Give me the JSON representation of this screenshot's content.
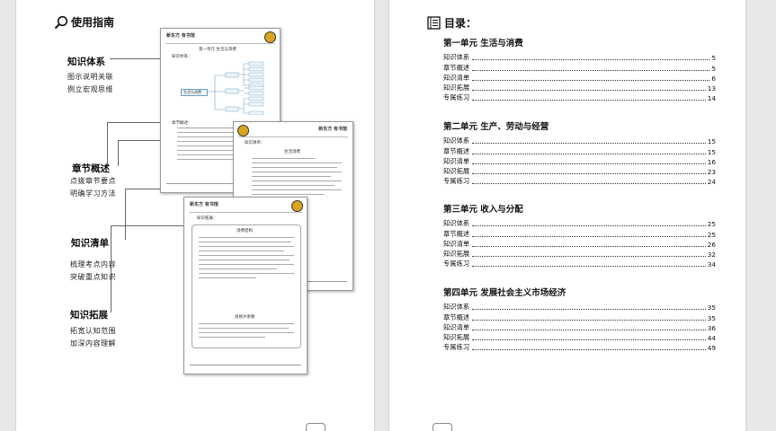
{
  "left_page": {
    "title": "使用指南",
    "sections": [
      {
        "label": "知识体系",
        "desc": [
          "图示说明关联",
          "例立宏观思维"
        ]
      },
      {
        "label": "章节概述",
        "desc": [
          "点拨章节要点",
          "明确学习方法"
        ]
      },
      {
        "label": "知识清单",
        "desc": [
          "梳理考点内容",
          "突破重点知识"
        ]
      },
      {
        "label": "知识拓展",
        "desc": [
          "拓宽认知范围",
          "加深内容理解"
        ]
      }
    ],
    "thumb1": {
      "brand": "新东方 有书馆",
      "unit": "第一单元 生活与消费",
      "heading1": "知识体系：",
      "center_node": "生活与消费",
      "heading2": "章节概述："
    },
    "thumb2": {
      "brand": "新东方 有书馆",
      "heading": "知识清单：",
      "subtitle": "生活消费"
    },
    "thumb3": {
      "brand": "新东方 有书馆",
      "heading": "知识拓展：",
      "subtitle": "消费结构",
      "subtitle2": "恩格尔系数"
    }
  },
  "toc": {
    "title": "目录：",
    "units": [
      {
        "title": "第一单元  生活与消费",
        "items": [
          {
            "label": "知识体系",
            "page": "5"
          },
          {
            "label": "章节概述",
            "page": "5"
          },
          {
            "label": "知识清单",
            "page": "6"
          },
          {
            "label": "知识拓展",
            "page": "13"
          },
          {
            "label": "专属练习",
            "page": "14"
          }
        ]
      },
      {
        "title": "第二单元  生产、劳动与经营",
        "items": [
          {
            "label": "知识体系",
            "page": "15"
          },
          {
            "label": "章节概述",
            "page": "15"
          },
          {
            "label": "知识清单",
            "page": "16"
          },
          {
            "label": "知识拓展",
            "page": "23"
          },
          {
            "label": "专属练习",
            "page": "24"
          }
        ]
      },
      {
        "title": "第三单元  收入与分配",
        "items": [
          {
            "label": "知识体系",
            "page": "25"
          },
          {
            "label": "章节概述",
            "page": "25"
          },
          {
            "label": "知识清单",
            "page": "26"
          },
          {
            "label": "知识拓展",
            "page": "32"
          },
          {
            "label": "专属练习",
            "page": "34"
          }
        ]
      },
      {
        "title": "第四单元  发展社会主义市场经济",
        "items": [
          {
            "label": "知识体系",
            "page": "35"
          },
          {
            "label": "章节概述",
            "page": "35"
          },
          {
            "label": "知识清单",
            "page": "36"
          },
          {
            "label": "知识拓展",
            "page": "44"
          },
          {
            "label": "专属练习",
            "page": "49"
          }
        ]
      }
    ]
  },
  "icons": {
    "guide": "magnifier-icon",
    "toc": "book-list-icon"
  }
}
